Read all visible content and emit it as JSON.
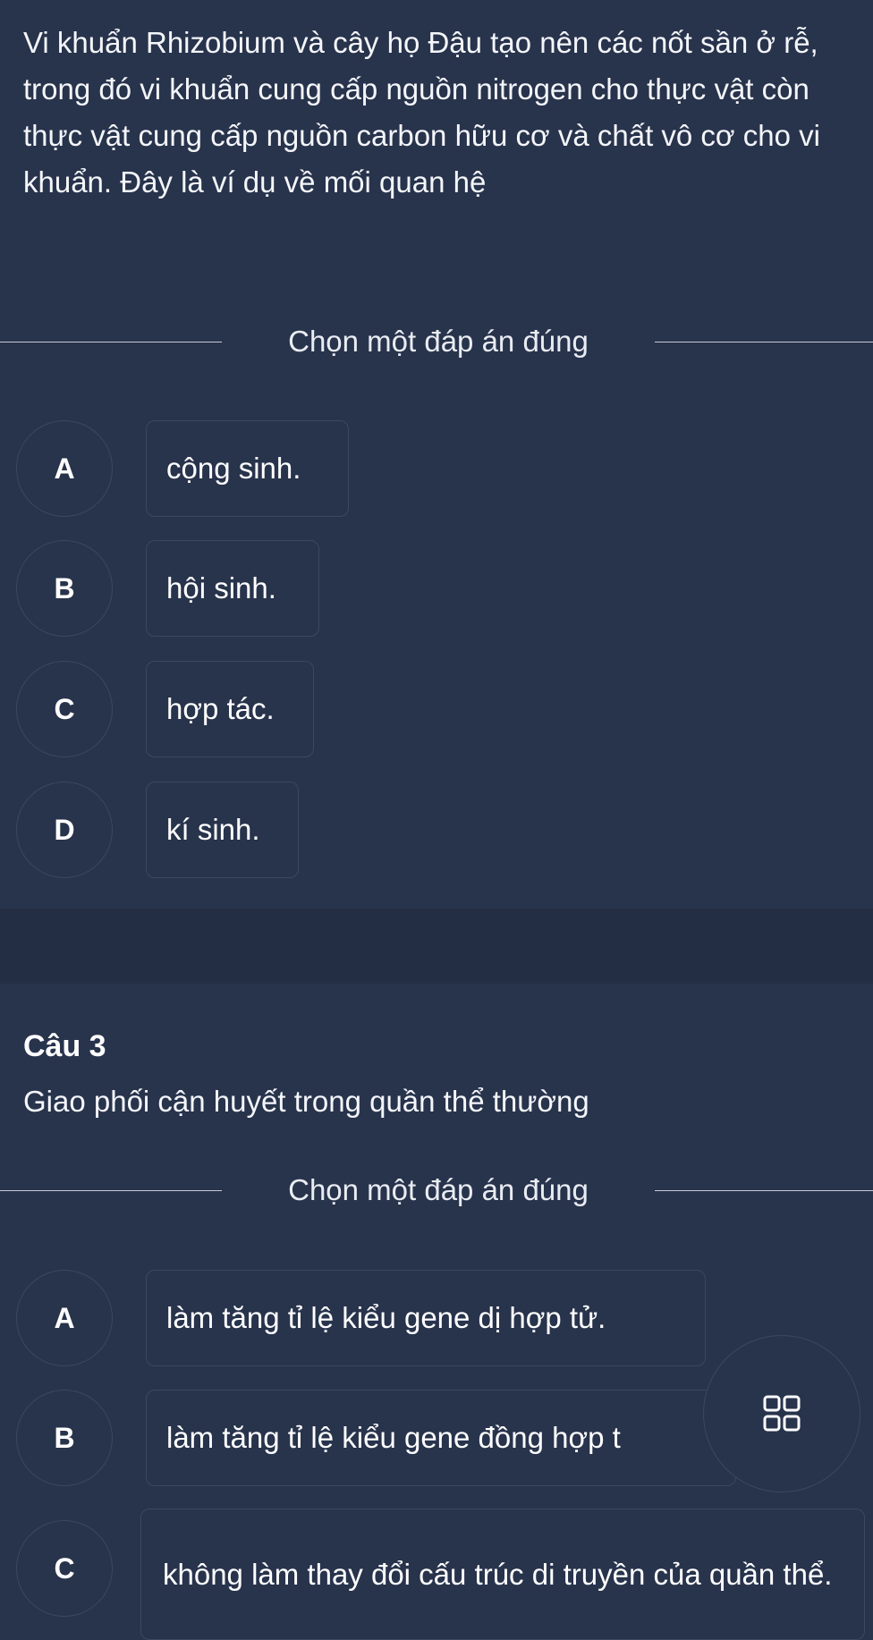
{
  "question2": {
    "text": "Vi khuẩn Rhizobium và cây họ Đậu tạo nên các nốt sần ở rễ, trong đó vi khuẩn cung cấp nguồn nitrogen cho thực vật còn thực vật cung cấp nguồn carbon hữu cơ và chất vô cơ cho vi khuẩn. Đây là ví dụ về mối quan hệ",
    "instruction": "Chọn một đáp án đúng",
    "options": [
      {
        "letter": "A",
        "text": "cộng sinh."
      },
      {
        "letter": "B",
        "text": "hội sinh."
      },
      {
        "letter": "C",
        "text": "hợp tác."
      },
      {
        "letter": "D",
        "text": "kí sinh."
      }
    ]
  },
  "question3": {
    "heading": "Câu 3",
    "text": "Giao phối cận huyết trong quần thể thường",
    "instruction": "Chọn một đáp án đúng",
    "options": [
      {
        "letter": "A",
        "text": "làm tăng tỉ lệ kiểu gene dị hợp tử."
      },
      {
        "letter": "B",
        "text": "làm tăng tỉ lệ kiểu gene đồng hợp t"
      },
      {
        "letter": "C",
        "text": "không làm thay đổi cấu trúc di truyền của quần thể."
      }
    ]
  },
  "floating_button": {
    "icon": "grid-icon"
  },
  "colors": {
    "background": "#28334c",
    "separator": "#232d43",
    "border": "#3c4763",
    "text": "#ffffff"
  }
}
